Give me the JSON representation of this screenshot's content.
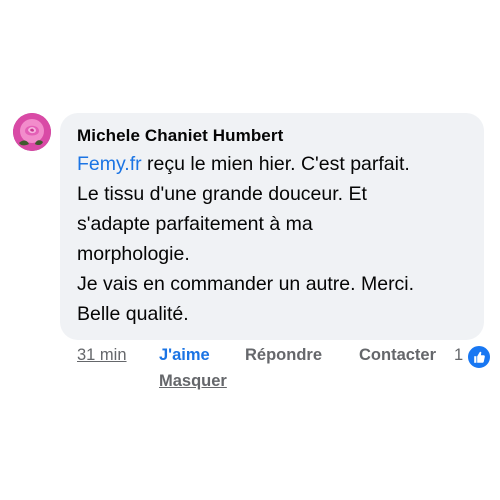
{
  "comment": {
    "author": "Michele Chaniet Humbert",
    "mention": "Femy.fr",
    "lines": {
      "first_rest": " reçu le mien hier. C'est parfait.",
      "l2": "Le tissu d'une grande douceur. Et",
      "l3": "s'adapte parfaitement à ma",
      "l4": "morphologie.",
      "l5": "Je vais en commander un autre. Merci.",
      "l6": "Belle qualité."
    },
    "avatar_icon": "rose-avatar"
  },
  "actions": {
    "time": "31 min",
    "like": "J'aime",
    "reply": "Répondre",
    "contact": "Contacter",
    "reaction_count": "1",
    "reaction_icon": "thumbs-up-icon",
    "hide": "Masquer"
  },
  "colors": {
    "bubble": "#f0f2f5",
    "link": "#1b74e4",
    "secondary_text": "#65676b",
    "like_badge": "#1877f2"
  }
}
